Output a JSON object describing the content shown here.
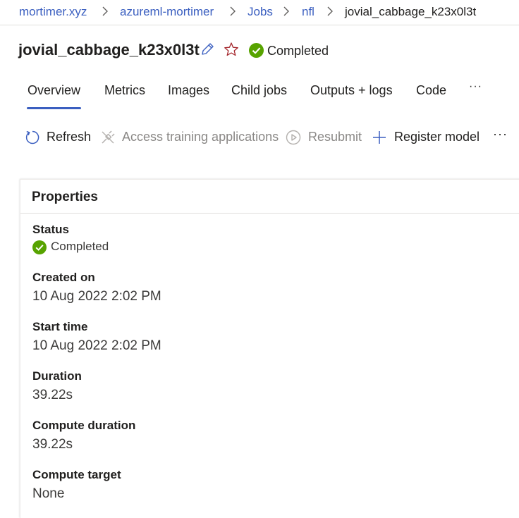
{
  "breadcrumb": {
    "items": [
      "mortimer.xyz",
      "azureml-mortimer",
      "Jobs",
      "nfl",
      "jovial_cabbage_k23x0l3t"
    ]
  },
  "header": {
    "title": "jovial_cabbage_k23x0l3t",
    "status": "Completed",
    "icons": {
      "edit": "pencil-icon",
      "favorite": "star-icon",
      "status": "check-circle-icon"
    }
  },
  "tabs": {
    "items": [
      "Overview",
      "Metrics",
      "Images",
      "Child jobs",
      "Outputs + logs",
      "Code"
    ],
    "active": "Overview",
    "more": "···"
  },
  "toolbar": {
    "refresh": "Refresh",
    "access_training": "Access training applications",
    "resubmit": "Resubmit",
    "register_model": "Register model",
    "more": "···"
  },
  "properties": {
    "title": "Properties",
    "status_label": "Status",
    "status_value": "Completed",
    "created_label": "Created on",
    "created_value": "10 Aug 2022 2:02 PM",
    "start_label": "Start time",
    "start_value": "10 Aug 2022 2:02 PM",
    "duration_label": "Duration",
    "duration_value": "39.22s",
    "compute_duration_label": "Compute duration",
    "compute_duration_value": "39.22s",
    "compute_target_label": "Compute target",
    "compute_target_value": "None"
  },
  "colors": {
    "link": "#3b5fc0",
    "success": "#57a300",
    "favorite": "#a4262c",
    "disabled": "#8a8886"
  }
}
